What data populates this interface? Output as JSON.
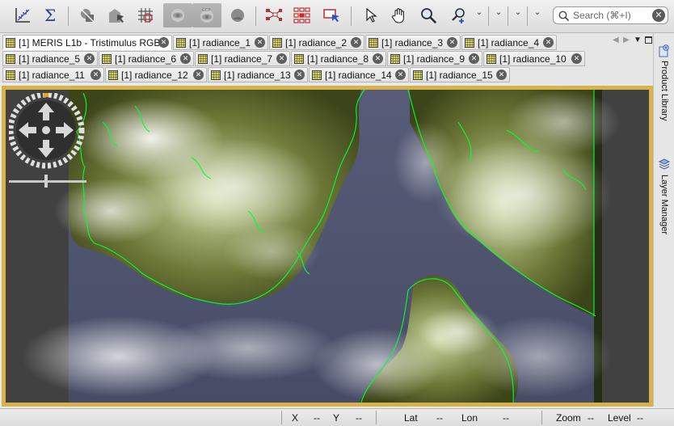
{
  "toolbar": {
    "tools": [
      {
        "name": "scatter-plot-tool"
      },
      {
        "name": "statistics-tool"
      },
      {
        "name": "mask-tool"
      },
      {
        "name": "range-finder-tool"
      },
      {
        "name": "grid-tool"
      },
      {
        "name": "sync-views-tool"
      },
      {
        "name": "gcp-tool"
      },
      {
        "name": "pin-tool"
      },
      {
        "name": "graph-tool"
      },
      {
        "name": "matrix-tool"
      },
      {
        "name": "product-display-tool"
      },
      {
        "name": "select-tool"
      },
      {
        "name": "pan-tool"
      },
      {
        "name": "zoom-tool"
      },
      {
        "name": "zoom-in-tool"
      }
    ],
    "search_placeholder": "Search (⌘+I)"
  },
  "tabs": [
    {
      "label": "[1] MERIS L1b - Tristimulus RGB",
      "active": true
    },
    {
      "label": "[1] radiance_1"
    },
    {
      "label": "[1] radiance_2"
    },
    {
      "label": "[1] radiance_3"
    },
    {
      "label": "[1] radiance_4"
    },
    {
      "label": "[1] radiance_5"
    },
    {
      "label": "[1] radiance_6"
    },
    {
      "label": "[1] radiance_7"
    },
    {
      "label": "[1] radiance_8"
    },
    {
      "label": "[1] radiance_9"
    },
    {
      "label": "[1] radiance_10"
    },
    {
      "label": "[1] radiance_11"
    },
    {
      "label": "[1] radiance_12"
    },
    {
      "label": "[1] radiance_13"
    },
    {
      "label": "[1] radiance_14"
    },
    {
      "label": "[1] radiance_15"
    }
  ],
  "side_panel": {
    "product_library": "Product Library",
    "layer_manager": "Layer Manager"
  },
  "statusbar": {
    "x_label": "X",
    "x_value": "--",
    "y_label": "Y",
    "y_value": "--",
    "lat_label": "Lat",
    "lat_value": "--",
    "lon_label": "Lon",
    "lon_value": "--",
    "zoom_label": "Zoom",
    "zoom_value": "--",
    "level_label": "Level",
    "level_value": "--"
  },
  "colors": {
    "view_border": "#d7b24a",
    "coastline": "#00ff33",
    "sea": "#4a5068",
    "land": "#4a5020"
  }
}
